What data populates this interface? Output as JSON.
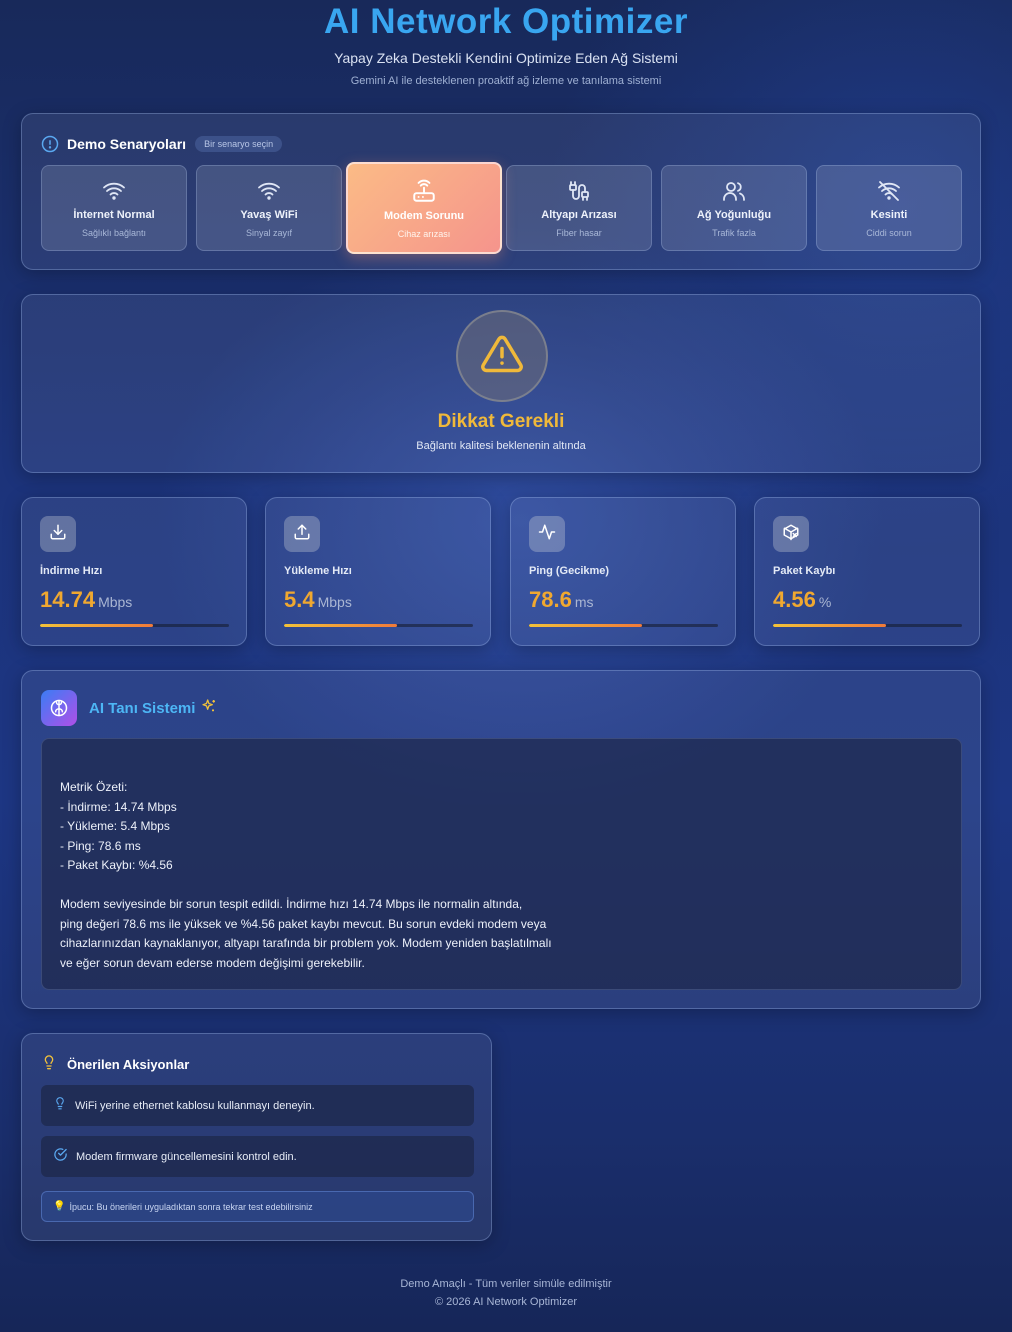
{
  "header": {
    "title": "AI Network Optimizer",
    "subtitle": "Yapay Zeka Destekli Kendini Optimize Eden Ağ Sistemi",
    "description": "Gemini AI ile desteklenen proaktif ağ izleme ve tanılama sistemi"
  },
  "scenarios": {
    "title": "Demo Senaryoları",
    "badge": "Bir senaryo seçin",
    "items": [
      {
        "label": "İnternet Normal",
        "sub": "Sağlıklı bağlantı",
        "icon": "wifi-icon"
      },
      {
        "label": "Yavaş WiFi",
        "sub": "Sinyal zayıf",
        "icon": "wifi-icon"
      },
      {
        "label": "Modem Sorunu",
        "sub": "Cihaz arızası",
        "icon": "router-icon",
        "active": true
      },
      {
        "label": "Altyapı Arızası",
        "sub": "Fiber hasar",
        "icon": "cable-icon"
      },
      {
        "label": "Ağ Yoğunluğu",
        "sub": "Trafik fazla",
        "icon": "users-icon"
      },
      {
        "label": "Kesinti",
        "sub": "Ciddi sorun",
        "icon": "wifi-off-icon"
      }
    ]
  },
  "status": {
    "title": "Dikkat Gerekli",
    "description": "Bağlantı kalitesi beklenenin altında",
    "icon": "warning-icon",
    "color": "#f0b93a"
  },
  "metrics": [
    {
      "label": "İndirme Hızı",
      "value": "14.74",
      "unit": "Mbps",
      "icon": "download-icon",
      "level": 0.6
    },
    {
      "label": "Yükleme Hızı",
      "value": "5.4",
      "unit": "Mbps",
      "icon": "upload-icon",
      "level": 0.6
    },
    {
      "label": "Ping (Gecikme)",
      "value": "78.6",
      "unit": "ms",
      "icon": "activity-icon",
      "level": 0.6
    },
    {
      "label": "Paket Kaybı",
      "value": "4.56",
      "unit": "%",
      "icon": "package-icon",
      "level": 0.6
    }
  ],
  "ai": {
    "title": "AI Tanı Sistemi",
    "text": "Metrik Özeti:\n- İndirme: 14.74 Mbps\n- Yükleme: 5.4 Mbps\n- Ping: 78.6 ms\n- Paket Kaybı: %4.56\n\nModem seviyesinde bir sorun tespit edildi. İndirme hızı 14.74 Mbps ile normalin altında,\nping değeri 78.6 ms ile yüksek ve %4.56 paket kaybı mevcut. Bu sorun evdeki modem veya\ncihazlarınızdan kaynaklanıyor, altyapı tarafında bir problem yok. Modem yeniden başlatılmalı\nve eğer sorun devam ederse modem değişimi gerekebilir."
  },
  "recommendations": {
    "title": "Önerilen Aksiyonlar",
    "items": [
      {
        "text": "WiFi yerine ethernet kablosu kullanmayı deneyin.",
        "icon": "lightbulb-icon"
      },
      {
        "text": "Modem firmware güncellemesini kontrol edin.",
        "icon": "check-circle-icon"
      }
    ],
    "tip": "İpucu: Bu önerileri uyguladıktan sonra tekrar test edebilirsiniz"
  },
  "footer": {
    "line1": "Demo Amaçlı - Tüm veriler simüle edilmiştir",
    "line2": "© 2026 AI Network Optimizer"
  },
  "colors": {
    "accent": "#39a6f0",
    "warning": "#f0b93a",
    "metric_value": "#f0a830"
  }
}
